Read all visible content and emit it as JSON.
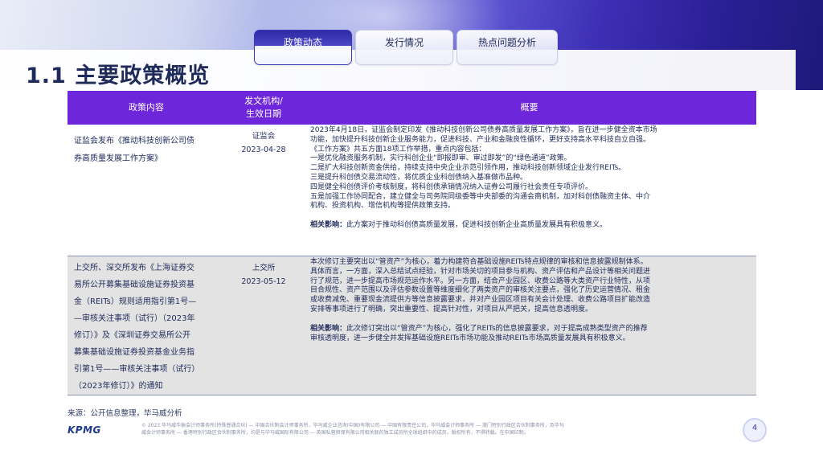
{
  "tabs": [
    {
      "label": "政策动态",
      "active": true
    },
    {
      "label": "发行情况",
      "active": false
    },
    {
      "label": "热点问题分析",
      "active": false
    }
  ],
  "page_title": "1.1 主要政策概览",
  "table": {
    "headers": [
      "政策内容",
      "发文机构/\n生效日期",
      "概要"
    ],
    "rows": [
      {
        "content_lines": [
          "证监会发布《推动科技创新公司债",
          "券高质量发展工作方案》"
        ],
        "agency": "证监会",
        "date": "2023-04-28",
        "overview_lines": [
          "2023年4月18日，证监会制定印发《推动科技创新公司债券高质量发展工作方案》，旨在进一步健全资本市场",
          "功能，加快提升科技创新企业服务能力，促进科技、产业和金融良性循环，更好支持高水平科技自立自强。",
          "《工作方案》共五方面18项工作举措，重点内容包括：",
          "一是优化融资服务机制，实行科创企业“即报即审、审过即发”的“绿色通道”政策。",
          "二是扩大科技创新资金供给，持续支持中央企业示范引领作用，推动科技创新领域企业发行REITs。",
          "三是提升科创债交易流动性，将优质企业科创债纳入基准做市品种。",
          "四是健全科创债评价考核制度，将科创债承销情况纳入证券公司履行社会责任专项评价。",
          "五是加强工作协同配合，建立健全与司务院同级委等中央部委的沟通会商机制，加对科创债融资主体、中介",
          "机构、投资机构、增信机构等提供政策支持。"
        ],
        "impact_label": "相关影响：",
        "impact_lines": [
          "此方案对于推动科创债高质量发展，促进科技创新企业高质量发展具有积极意义。"
        ]
      },
      {
        "content_lines": [
          "上交所、深交所发布《上海证券交",
          "易所公开募集基础设施证券投资基",
          "金（REITs）规则适用指引第1号—",
          "—审核关注事项（试行）（2023年",
          "修订）》及《深圳证券交易所公开",
          "募集基础设施证券投资基金业务指",
          "引第1号——审核关注事项（试行）",
          "（2023年修订）》的通知"
        ],
        "agency": "上交所",
        "date": "2023-05-12",
        "overview_lines": [
          "本次修订主要突出以“管资产”为核心，着力构建符合基础设施REITs特点规律的审核和信息披露规制体系。",
          "具体而言，一方面，深入总结试点经验，针对市场关切的项目参与机构、资产评估和产品设计等相关问题进",
          "行了规范，进一步提高市场规范运作水平。另一方面，结合产业园区、收费公路等大类资产行业特性，从项",
          "目合规性、资产范围以及评估参数设置等维度细化了两类资产的审核关注要点，强化了历史运营情况、租金",
          "或收费减免、重要现金流提供方等信息披露要求，并对产业园区项目有关会计处理、收费公路项目扩能改造",
          "安排等事项进行了明确，突出重要性、提高针对性，对项目从严把关，提高信息透明度。"
        ],
        "impact_label": "相关影响：",
        "impact_lines": [
          "此次修订突出以“管资产”为核心，强化了REITs的信息披露要求，对于提高成熟类型资产的推荐",
          "审核透明度，进一步健全并发挥基础设施REITs市场功能及推动REITs市场高质量发展具有积极意义。"
        ]
      }
    ]
  },
  "source_text": "来源：公开信息整理，毕马威分析",
  "footnote_lines": [
    "© 2023 毕马威华振会计师事务所(特殊普通合伙) — 中国合伙制会计师事务所，毕马威企业咨询(中国)有限公司 — 中国有限责任公司，毕马威会计师事务所 — 澳门特别行政区合伙制事务所，及毕马",
    "威会计师事务所 — 香港特别行政区合伙制事务所，均是与毕马威国际有限公司 — 英国私营担保有限公司相关联的独立成员所全球组织中的成员。版权所有，不得转载。在中国印制。"
  ],
  "logo_text": "KPMG",
  "page_number": "4",
  "colors": {
    "header_bg": "#6d26d9",
    "title": "#1e2a5a",
    "row_alt": "#e3e3e3"
  }
}
